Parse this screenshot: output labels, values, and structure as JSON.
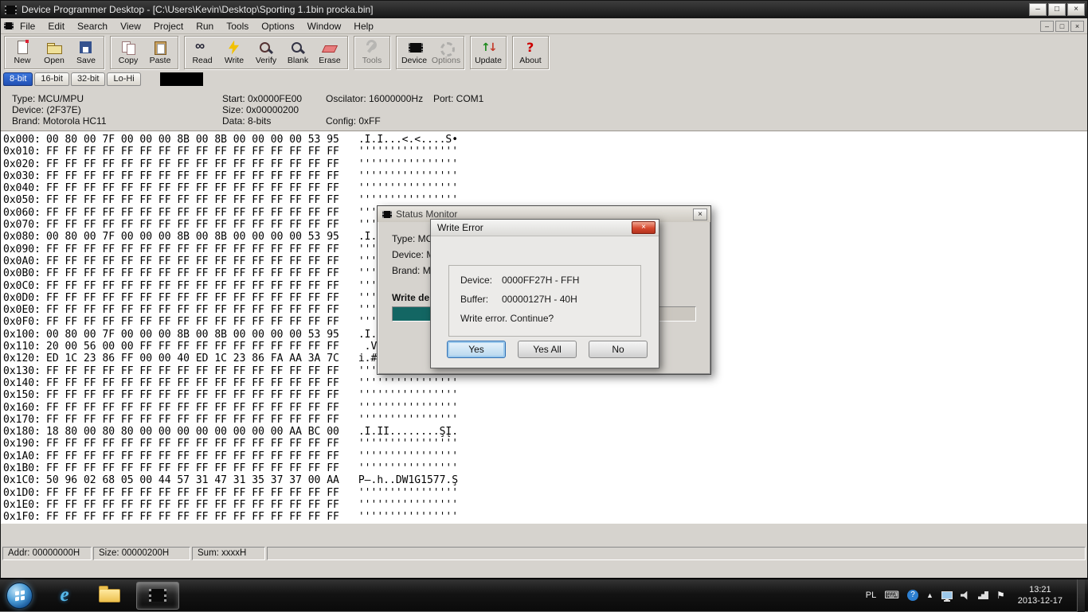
{
  "window": {
    "title": "Device Programmer Desktop - [C:\\Users\\Kevin\\Desktop\\Sporting 1.1bin procka.bin]",
    "controls": {
      "minimize": "–",
      "maximize": "□",
      "close": "×"
    }
  },
  "menu": {
    "items": [
      "File",
      "Edit",
      "Search",
      "View",
      "Project",
      "Run",
      "Tools",
      "Options",
      "Window",
      "Help"
    ]
  },
  "toolbar": {
    "groups": [
      {
        "buttons": [
          {
            "id": "new",
            "label": "New",
            "enabled": true
          },
          {
            "id": "open",
            "label": "Open",
            "enabled": true
          },
          {
            "id": "save",
            "label": "Save",
            "enabled": true
          }
        ]
      },
      {
        "buttons": [
          {
            "id": "copy",
            "label": "Copy",
            "enabled": true
          },
          {
            "id": "paste",
            "label": "Paste",
            "enabled": true
          }
        ]
      },
      {
        "buttons": [
          {
            "id": "read",
            "label": "Read",
            "enabled": true
          },
          {
            "id": "write",
            "label": "Write",
            "enabled": true
          },
          {
            "id": "verify",
            "label": "Verify",
            "enabled": true
          },
          {
            "id": "blank",
            "label": "Blank",
            "enabled": true
          },
          {
            "id": "erase",
            "label": "Erase",
            "enabled": true
          }
        ]
      },
      {
        "buttons": [
          {
            "id": "tools",
            "label": "Tools",
            "enabled": false
          }
        ]
      },
      {
        "buttons": [
          {
            "id": "device",
            "label": "Device",
            "enabled": true
          },
          {
            "id": "options",
            "label": "Options",
            "enabled": false
          }
        ]
      },
      {
        "buttons": [
          {
            "id": "update",
            "label": "Update",
            "enabled": true
          }
        ]
      },
      {
        "buttons": [
          {
            "id": "about",
            "label": "About",
            "enabled": true
          }
        ]
      }
    ]
  },
  "tabs": [
    {
      "label": "8-bit",
      "active": true
    },
    {
      "label": "16-bit",
      "active": false
    },
    {
      "label": "32-bit",
      "active": false
    },
    {
      "label": "Lo-Hi",
      "active": false
    }
  ],
  "info": {
    "columns": [
      [
        "Type: MCU/MPU",
        "Device: (2F37E)",
        "Brand: Motorola HC11"
      ],
      [
        "Start: 0x0000FE00",
        "Size: 0x00000200",
        "Data: 8-bits"
      ],
      [
        "Oscilator: 16000000Hz",
        "",
        "Config: 0xFF"
      ],
      [
        "Port: COM1"
      ]
    ]
  },
  "hex": {
    "rows": [
      {
        "addr": "0x000:",
        "bytes": "00 80 00 7F 00 00 00 8B 00 8B 00 00 00 00 53 95",
        "ascii": ".I.I...<.<....S•"
      },
      {
        "addr": "0x010:",
        "bytes": "FF FF FF FF FF FF FF FF FF FF FF FF FF FF FF FF",
        "ascii": "''''''''''''''''"
      },
      {
        "addr": "0x020:",
        "bytes": "FF FF FF FF FF FF FF FF FF FF FF FF FF FF FF FF",
        "ascii": "''''''''''''''''"
      },
      {
        "addr": "0x030:",
        "bytes": "FF FF FF FF FF FF FF FF FF FF FF FF FF FF FF FF",
        "ascii": "''''''''''''''''"
      },
      {
        "addr": "0x040:",
        "bytes": "FF FF FF FF FF FF FF FF FF FF FF FF FF FF FF FF",
        "ascii": "''''''''''''''''"
      },
      {
        "addr": "0x050:",
        "bytes": "FF FF FF FF FF FF FF FF FF FF FF FF FF FF FF FF",
        "ascii": "''''''''''''''''"
      },
      {
        "addr": "0x060:",
        "bytes": "FF FF FF FF FF FF FF FF FF FF FF FF FF FF FF FF",
        "ascii": "''''''''''''''''"
      },
      {
        "addr": "0x070:",
        "bytes": "FF FF FF FF FF FF FF FF FF FF FF FF FF FF FF FF",
        "ascii": "''''''''''''''''"
      },
      {
        "addr": "0x080:",
        "bytes": "00 80 00 7F 00 00 00 8B 00 8B 00 00 00 00 53 95",
        "ascii": ".I.I...<.<....S•"
      },
      {
        "addr": "0x090:",
        "bytes": "FF FF FF FF FF FF FF FF FF FF FF FF FF FF FF FF",
        "ascii": "''''''''''''''''"
      },
      {
        "addr": "0x0A0:",
        "bytes": "FF FF FF FF FF FF FF FF FF FF FF FF FF FF FF FF",
        "ascii": "''''''''''''''''"
      },
      {
        "addr": "0x0B0:",
        "bytes": "FF FF FF FF FF FF FF FF FF FF FF FF FF FF FF FF",
        "ascii": "''''''''''''''''"
      },
      {
        "addr": "0x0C0:",
        "bytes": "FF FF FF FF FF FF FF FF FF FF FF FF FF FF FF FF",
        "ascii": "''''''''''''''''"
      },
      {
        "addr": "0x0D0:",
        "bytes": "FF FF FF FF FF FF FF FF FF FF FF FF FF FF FF FF",
        "ascii": "''''''''''''''''"
      },
      {
        "addr": "0x0E0:",
        "bytes": "FF FF FF FF FF FF FF FF FF FF FF FF FF FF FF FF",
        "ascii": "''''''''''''''''"
      },
      {
        "addr": "0x0F0:",
        "bytes": "FF FF FF FF FF FF FF FF FF FF FF FF FF FF FF FF",
        "ascii": "''''''''''''''''"
      },
      {
        "addr": "0x100:",
        "bytes": "00 80 00 7F 00 00 00 8B 00 8B 00 00 00 00 53 95",
        "ascii": ".I.I...<.<....S•"
      },
      {
        "addr": "0x110:",
        "bytes": "20 00 56 00 00 FF FF FF FF FF FF FF FF FF FF FF",
        "ascii": " .V..'''''''''''"
      },
      {
        "addr": "0x120:",
        "bytes": "ED 1C 23 86 FF 00 00 40 ED 1C 23 86 FA AA 3A 7C",
        "ascii": "i.#.'..@i.#...:|"
      },
      {
        "addr": "0x130:",
        "bytes": "FF FF FF FF FF FF FF FF FF FF FF FF FF FF FF FF",
        "ascii": "''''''''''''''''"
      },
      {
        "addr": "0x140:",
        "bytes": "FF FF FF FF FF FF FF FF FF FF FF FF FF FF FF FF",
        "ascii": "''''''''''''''''"
      },
      {
        "addr": "0x150:",
        "bytes": "FF FF FF FF FF FF FF FF FF FF FF FF FF FF FF FF",
        "ascii": "''''''''''''''''"
      },
      {
        "addr": "0x160:",
        "bytes": "FF FF FF FF FF FF FF FF FF FF FF FF FF FF FF FF",
        "ascii": "''''''''''''''''"
      },
      {
        "addr": "0x170:",
        "bytes": "FF FF FF FF FF FF FF FF FF FF FF FF FF FF FF FF",
        "ascii": "''''''''''''''''"
      },
      {
        "addr": "0x180:",
        "bytes": "18 80 00 80 80 00 00 00 00 00 00 00 00 AA BC 00",
        "ascii": ".I.II........ŞĮ."
      },
      {
        "addr": "0x190:",
        "bytes": "FF FF FF FF FF FF FF FF FF FF FF FF FF FF FF FF",
        "ascii": "''''''''''''''''"
      },
      {
        "addr": "0x1A0:",
        "bytes": "FF FF FF FF FF FF FF FF FF FF FF FF FF FF FF FF",
        "ascii": "''''''''''''''''"
      },
      {
        "addr": "0x1B0:",
        "bytes": "FF FF FF FF FF FF FF FF FF FF FF FF FF FF FF FF",
        "ascii": "''''''''''''''''"
      },
      {
        "addr": "0x1C0:",
        "bytes": "50 96 02 68 05 00 44 57 31 47 31 35 37 37 00 AA",
        "ascii": "P–.h..DW1G1577.Ş"
      },
      {
        "addr": "0x1D0:",
        "bytes": "FF FF FF FF FF FF FF FF FF FF FF FF FF FF FF FF",
        "ascii": "''''''''''''''''"
      },
      {
        "addr": "0x1E0:",
        "bytes": "FF FF FF FF FF FF FF FF FF FF FF FF FF FF FF FF",
        "ascii": "''''''''''''''''"
      },
      {
        "addr": "0x1F0:",
        "bytes": "FF FF FF FF FF FF FF FF FF FF FF FF FF FF FF FF",
        "ascii": "''''''''''''''''"
      }
    ]
  },
  "statusbar": {
    "cells": [
      "Addr: 00000000H",
      "Size: 00000200H",
      "Sum: xxxxH"
    ]
  },
  "status_monitor": {
    "title": "Status Monitor",
    "lines": [
      "Type: MC",
      "Device: M",
      "Brand: M"
    ],
    "action_label": "Write de",
    "progress_percent": 40
  },
  "write_error": {
    "title": "Write Error",
    "device_label": "Device:",
    "device_value": "0000FF27H - FFH",
    "buffer_label": "Buffer:",
    "buffer_value": "00000127H - 40H",
    "message": "Write error. Continue?",
    "buttons": [
      "Yes",
      "Yes All",
      "No"
    ]
  },
  "taskbar": {
    "tray": {
      "language": "PL",
      "time": "13:21",
      "date": "2013-12-17"
    }
  }
}
